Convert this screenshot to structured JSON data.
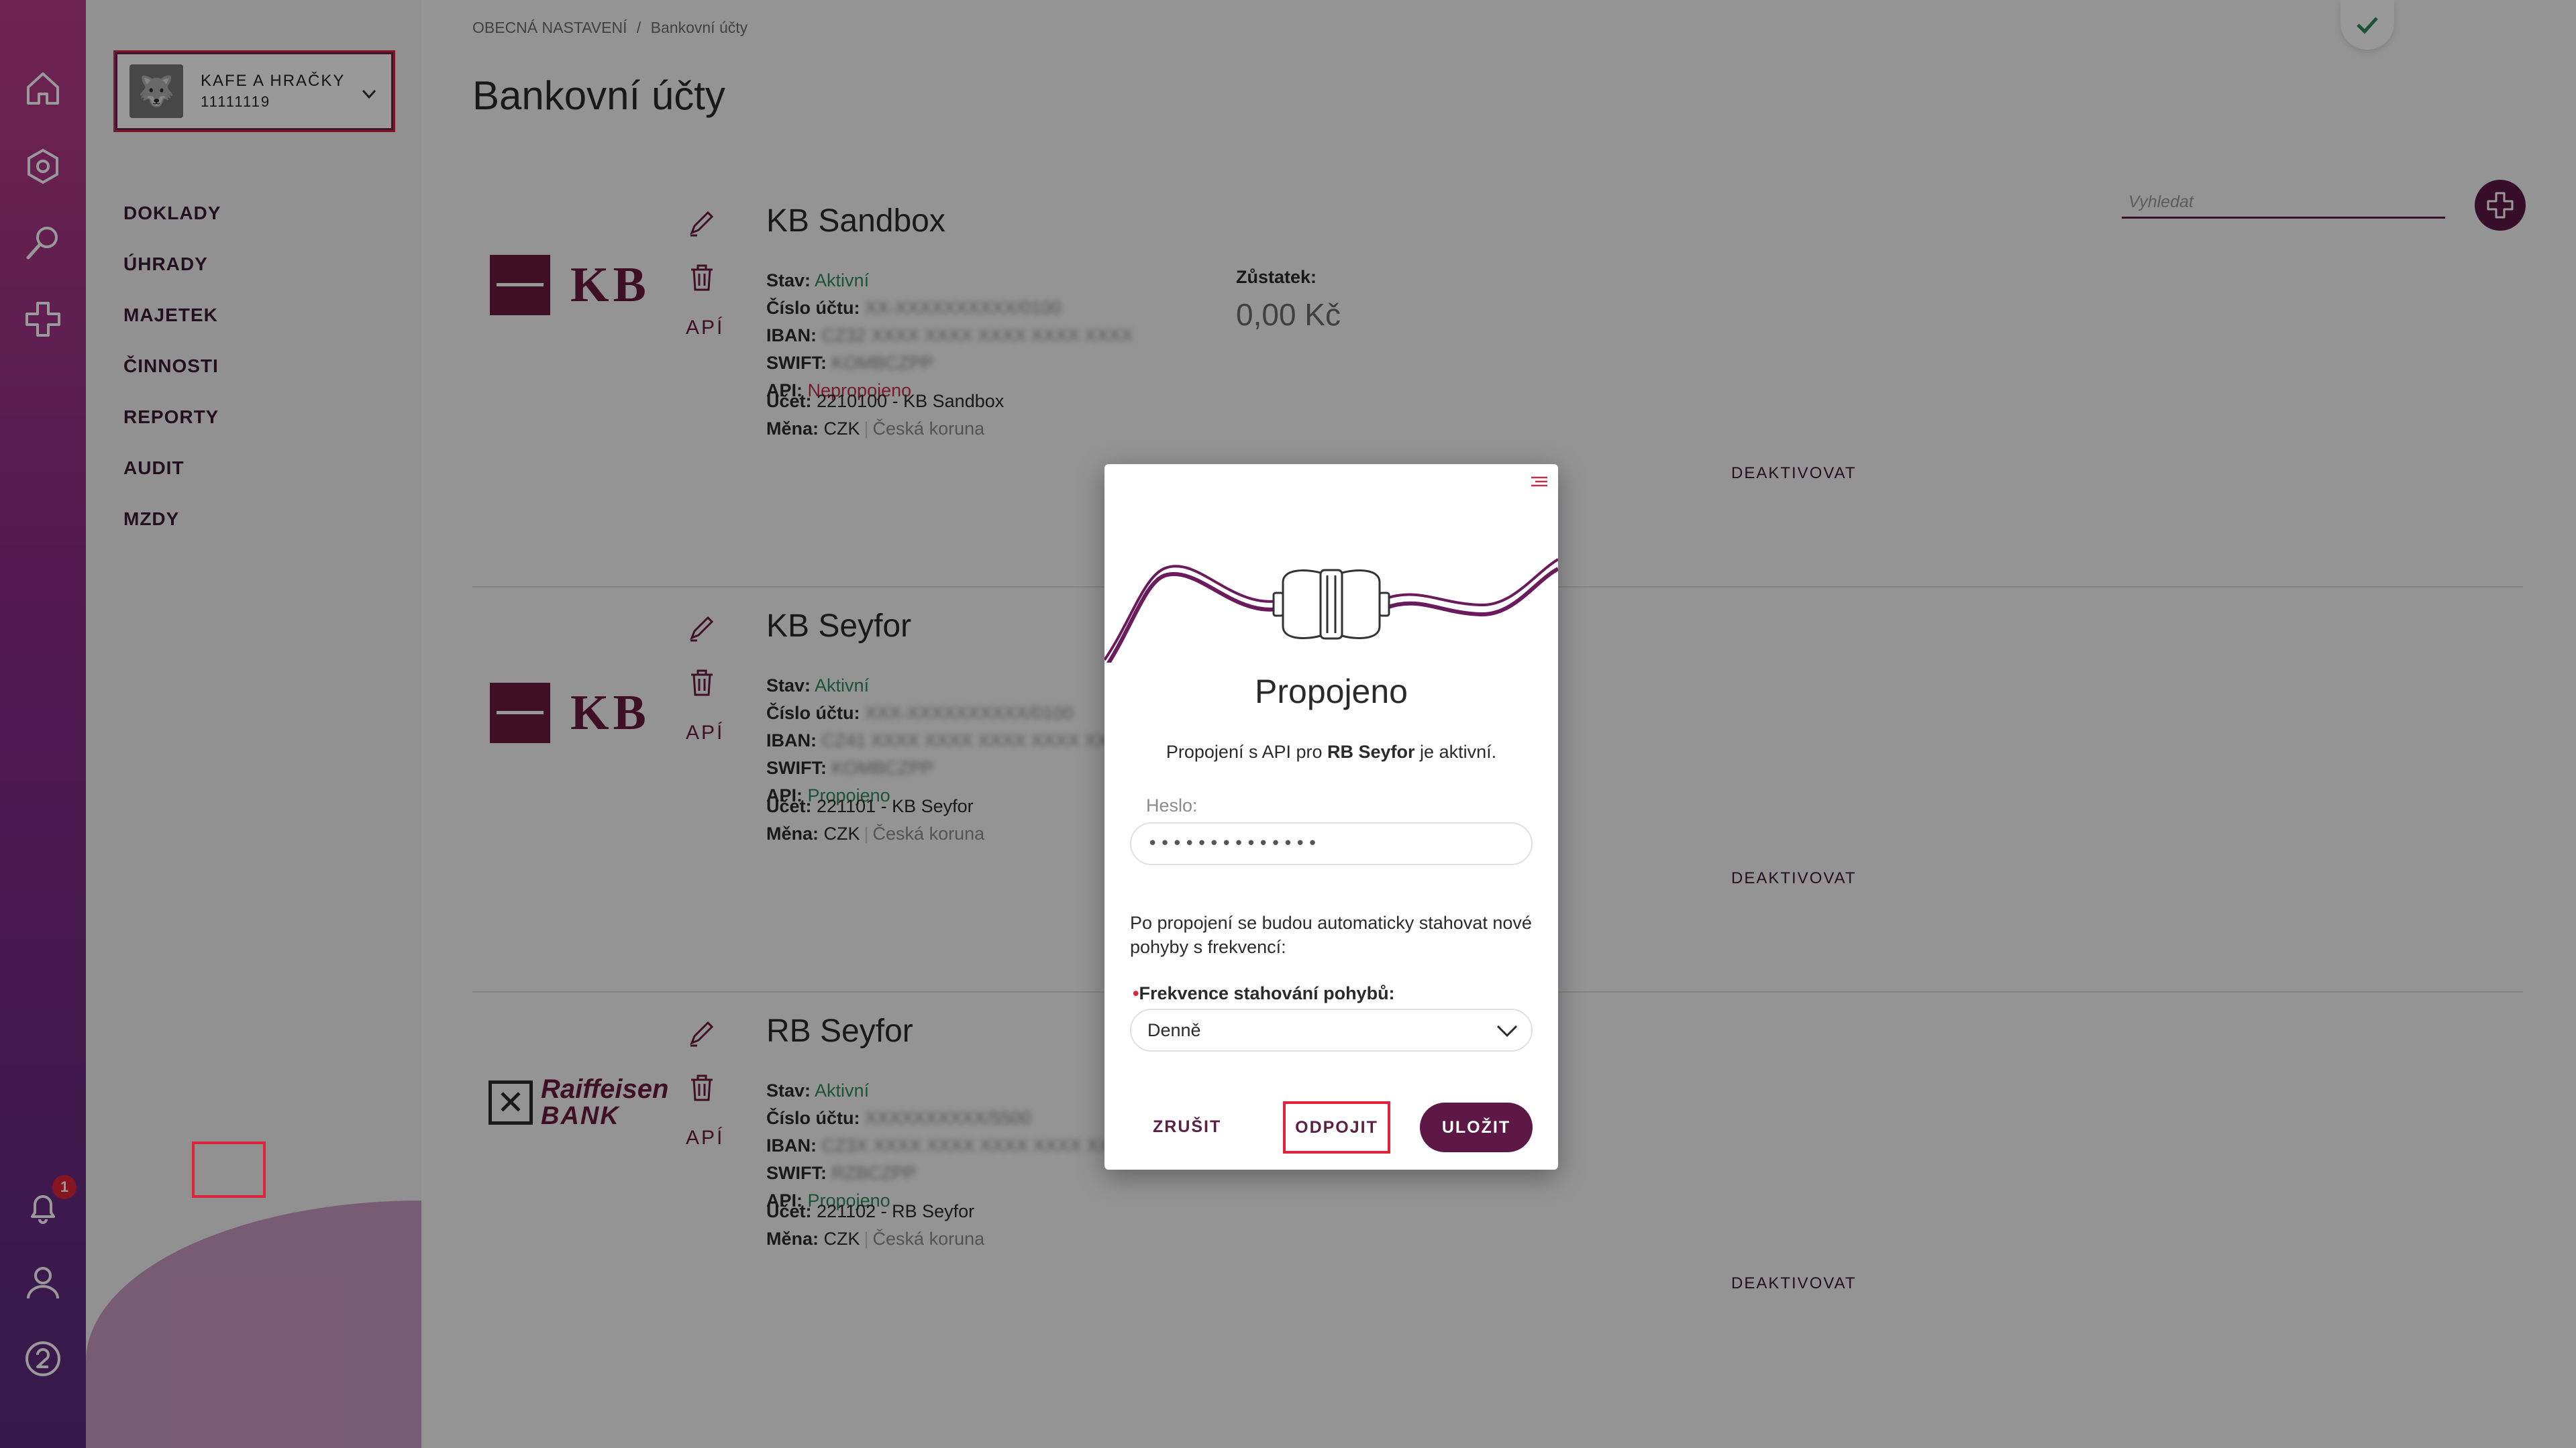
{
  "org": {
    "name": "KAFE A HRAČKY",
    "id": "11111119"
  },
  "menu": [
    "DOKLADY",
    "ÚHRADY",
    "MAJETEK",
    "ČINNOSTI",
    "REPORTY",
    "AUDIT",
    "MZDY"
  ],
  "rail": {
    "notification_count": "1"
  },
  "breadcrumb": {
    "parent": "OBECNÁ NASTAVENÍ",
    "sep": "/",
    "current": "Bankovní účty"
  },
  "page_title": "Bankovní účty",
  "search": {
    "placeholder": "Vyhledat"
  },
  "labels": {
    "stav": "Stav:",
    "cislo": "Číslo účtu:",
    "iban": "IBAN:",
    "swift": "SWIFT:",
    "api": "API:",
    "ucet": "Účet:",
    "mena": "Měna:",
    "zustatek": "Zůstatek:",
    "deactivate": "DEAKTIVOVAT",
    "api_button": "APÍ"
  },
  "accounts": [
    {
      "name": "KB Sandbox",
      "bank_logo": "KB",
      "status": "Aktivní",
      "number": "XX-XXXXXXXXXX/0100",
      "iban": "CZ32 XXXX XXXX XXXX XXXX XXXX",
      "swift": "KOMBCZPP",
      "api_status": "Nepropojeno",
      "account": "2210100 - KB Sandbox",
      "currency_code": "CZK",
      "currency_name": "Česká koruna",
      "balance": "0,00 Kč"
    },
    {
      "name": "KB Seyfor",
      "bank_logo": "KB",
      "status": "Aktivní",
      "number": "XXX-XXXXXXXXXX/0100",
      "iban": "CZ41 XXXX XXXX XXXX XXXX XXXX",
      "swift": "KOMBCZPP",
      "api_status": "Propojeno",
      "account": "221101 - KB Seyfor",
      "currency_code": "CZK",
      "currency_name": "Česká koruna"
    },
    {
      "name": "RB Seyfor",
      "bank_logo": "Raiffeisen BANK",
      "logo_line1": "Raiffeisen",
      "logo_line2": "BANK",
      "status": "Aktivní",
      "number": "XXXXXXXXXX/5500",
      "iban": "CZ3X XXXX XXXX XXXX XXXX XXX1",
      "swift": "RZBCZPP",
      "api_status": "Propojeno",
      "account": "221102 - RB Seyfor",
      "currency_code": "CZK",
      "currency_name": "Česká koruna"
    }
  ],
  "modal": {
    "title": "Propojeno",
    "desc_prefix": "Propojení s API pro ",
    "desc_bank": "RB Seyfor",
    "desc_suffix": " je aktivní.",
    "password_label": "Heslo:",
    "password_value": "••••••••••••••",
    "auto_text": "Po propojení se budou automaticky stahovat nové pohyby s frekvencí:",
    "freq_required_mark": "•",
    "freq_label": "Frekvence stahování pohybů:",
    "freq_value": "Denně",
    "cancel": "ZRUŠIT",
    "disconnect": "ODPOJIT",
    "save": "ULOŽIT"
  },
  "colors": {
    "brand": "#5d1845",
    "accent_red": "#e0243a",
    "status_green": "#2f8a5e",
    "status_red": "#c2304c"
  }
}
